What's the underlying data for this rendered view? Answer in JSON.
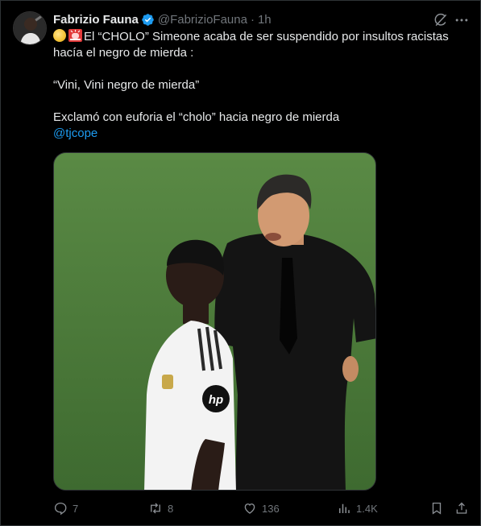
{
  "post": {
    "author_name": "Fabrizio Fauna",
    "handle": "@FabrizioFauna",
    "separator": "·",
    "time": "1h",
    "text_line1": "El “CHOLO” Simeone acaba de ser suspendido por insultos racistas hacía el negro de mierda :",
    "text_line2": "“Vini, Vini negro de mierda”",
    "text_line3": "Exclamó con euforia el “cholo” hacia negro de mierda",
    "mention": "@tjcope"
  },
  "actions": {
    "replies": "7",
    "reposts": "8",
    "likes": "136",
    "views": "1.4K"
  },
  "icons": {
    "verified": "verified-badge-icon",
    "grok": "grok-icon",
    "more": "more-icon",
    "reply": "reply-icon",
    "repost": "repost-icon",
    "like": "like-icon",
    "views": "views-icon",
    "bookmark": "bookmark-icon",
    "share": "share-icon"
  },
  "colors": {
    "background": "#000000",
    "text": "#e7e9ea",
    "muted": "#71767b",
    "accent": "#1d9bf0"
  }
}
